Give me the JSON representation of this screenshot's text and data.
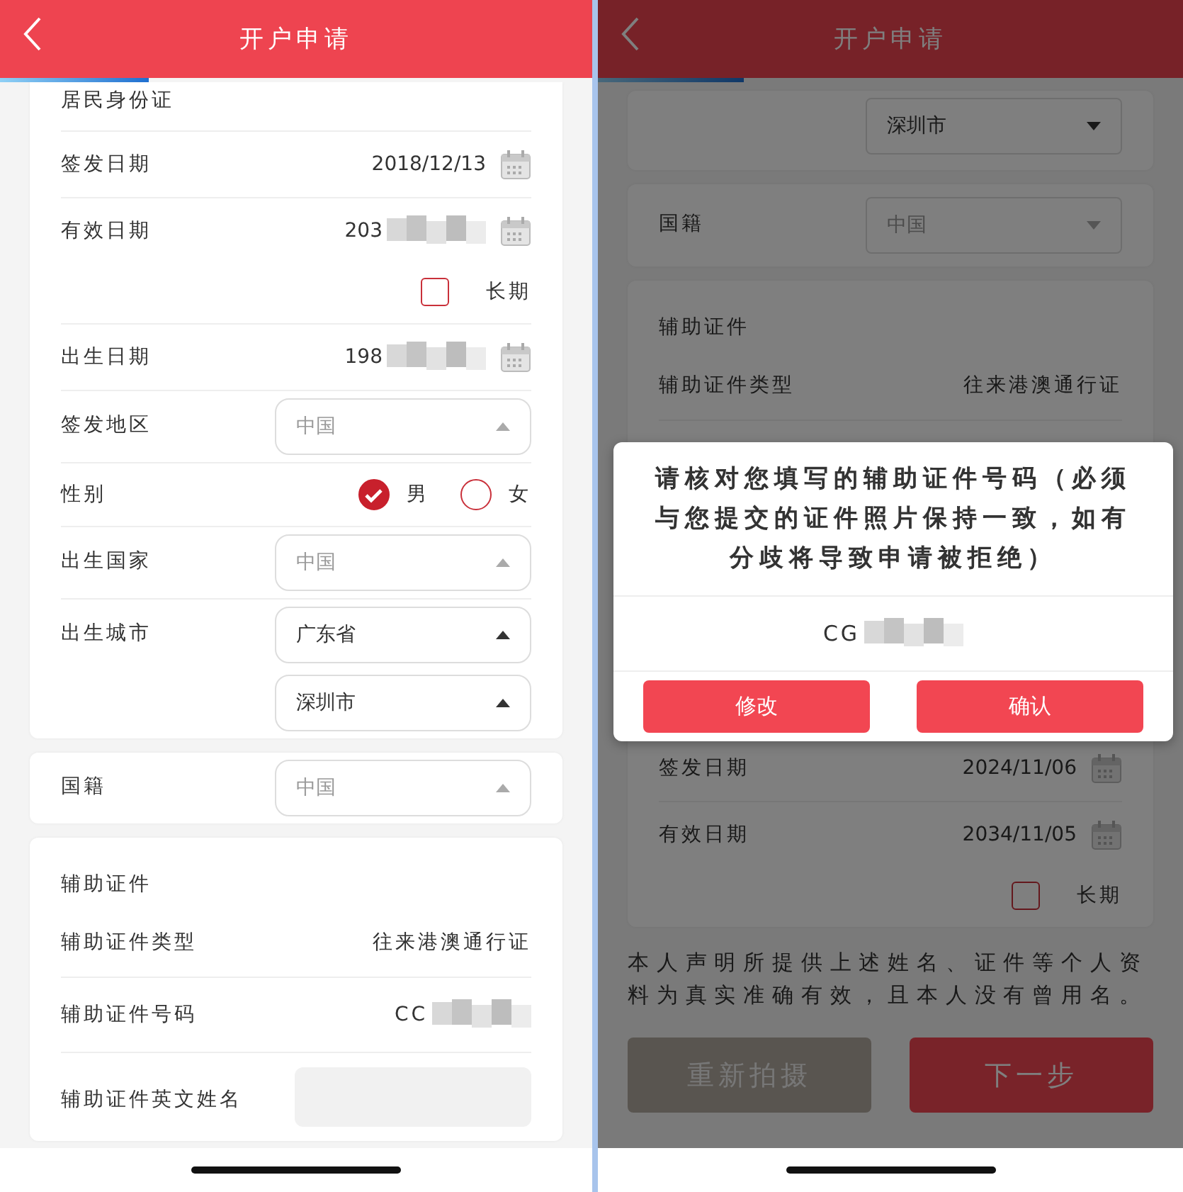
{
  "panels": [
    {
      "header": {
        "title": "开户申请"
      },
      "progress": {
        "level": 0.25
      },
      "sections": [
        {
          "rows": [
            {
              "kind": "heading",
              "label": "居民身份证"
            },
            {
              "kind": "date",
              "label": "签发日期",
              "value": "2018/12/13"
            },
            {
              "kind": "date",
              "label": "有效日期",
              "value": "203",
              "masked": true,
              "long_term": {
                "label": "长期",
                "checked": false
              }
            },
            {
              "kind": "date",
              "label": "出生日期",
              "value": "198",
              "masked": true
            },
            {
              "kind": "select",
              "label": "签发地区",
              "selects": [
                {
                  "value": "中国",
                  "dimmed": true
                }
              ]
            },
            {
              "kind": "radio",
              "label": "性别",
              "options": [
                {
                  "label": "男",
                  "selected": true
                },
                {
                  "label": "女",
                  "selected": false
                }
              ]
            },
            {
              "kind": "select",
              "label": "出生国家",
              "selects": [
                {
                  "value": "中国",
                  "dimmed": true
                }
              ]
            },
            {
              "kind": "select",
              "label": "出生城市",
              "selects": [
                {
                  "value": "广东省",
                  "dimmed": false
                },
                {
                  "value": "深圳市",
                  "dimmed": false
                }
              ]
            }
          ]
        },
        {
          "rows": [
            {
              "kind": "select",
              "label": "国籍",
              "selects": [
                {
                  "value": "中国",
                  "dimmed": true
                }
              ]
            }
          ]
        },
        {
          "rows": [
            {
              "kind": "heading",
              "label": "辅助证件"
            },
            {
              "kind": "text",
              "label": "辅助证件类型",
              "value": "往来港澳通行证"
            },
            {
              "kind": "text",
              "label": "辅助证件号码",
              "value": "CC",
              "masked": true
            },
            {
              "kind": "input",
              "label": "辅助证件英文姓名"
            }
          ]
        }
      ]
    },
    {
      "header": {
        "title": "开户申请"
      },
      "progress": {
        "level": 0.25
      },
      "sections": [
        {
          "rows": [
            {
              "kind": "select",
              "selects": [
                {
                  "value": "深圳市",
                  "dimmed": false
                }
              ]
            }
          ]
        },
        {
          "rows": [
            {
              "kind": "select",
              "label": "国籍",
              "selects": [
                {
                  "value": "中国",
                  "dimmed": true
                }
              ]
            }
          ]
        },
        {
          "rows": [
            {
              "kind": "heading",
              "label": "辅助证件"
            },
            {
              "kind": "text",
              "label": "辅助证件类型",
              "value": "往来港澳通行证"
            },
            {
              "kind": "date",
              "label": "签发日期",
              "value": "2024/11/06"
            },
            {
              "kind": "date",
              "label": "有效日期",
              "value": "2034/11/05",
              "long_term": {
                "label": "长期",
                "checked": false
              }
            }
          ]
        }
      ],
      "declaration": "本人声明所提供上述姓名、证件等个人资料为真实准确有效，且本人没有曾用名。",
      "buttons": [
        {
          "label": "重新拍摄",
          "kind": "secondary"
        },
        {
          "label": "下一步",
          "kind": "primary"
        }
      ],
      "dialog": {
        "message": "请核对您填写的辅助证件号码（必须与您提交的证件照片保持一致，如有分歧将导致申请被拒绝）",
        "code": "CG",
        "masked": true,
        "buttons": [
          {
            "label": "修改"
          },
          {
            "label": "确认"
          }
        ]
      }
    }
  ]
}
